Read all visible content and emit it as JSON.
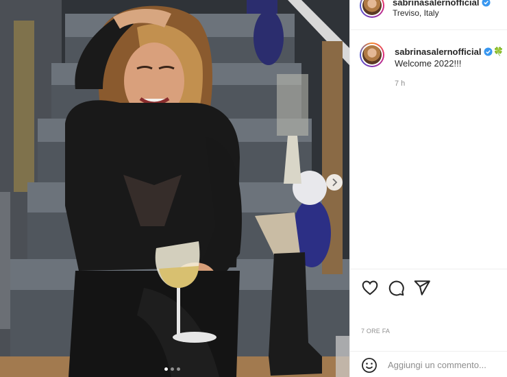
{
  "post": {
    "username": "sabrinasalernofficial",
    "location": "Treviso, Italy",
    "carousel": {
      "total_slides": 3,
      "active_slide": 1
    }
  },
  "caption": {
    "username": "sabrinasalernofficial",
    "emoji": "🍀",
    "text": "Welcome 2022!!!",
    "time": "7 h"
  },
  "post_meta": {
    "time": "7 ORE FA"
  },
  "add_comment": {
    "placeholder": "Aggiungi un commento..."
  },
  "icons": {
    "like": "heart-icon",
    "comment": "comment-icon",
    "share": "paper-plane-icon",
    "emoji": "smiley-icon",
    "verified": "verified-badge-icon",
    "next": "chevron-right-icon"
  },
  "colors": {
    "verified": "#3897f0",
    "text": "#262626",
    "muted": "#8e8e8e",
    "divider": "#efefef"
  }
}
